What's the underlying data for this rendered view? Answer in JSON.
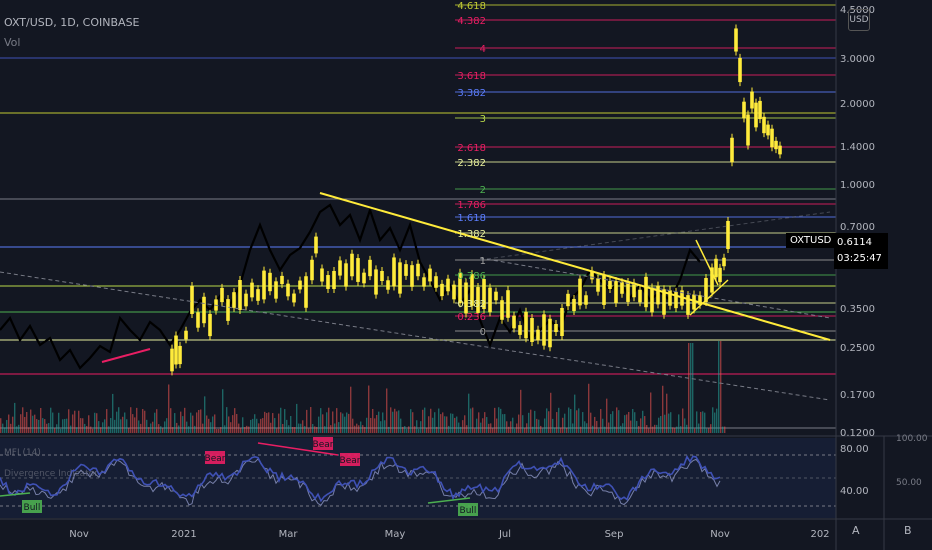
{
  "header": {
    "symbol_line": "OXT/USD, 1D, COINBASE",
    "volume_label": "Vol",
    "currency_button": "USD"
  },
  "price_axis": {
    "ticks": [
      "4.5000",
      "3.0000",
      "2.0000",
      "1.4000",
      "1.0000",
      "0.7000",
      "0.3500",
      "0.2500",
      "0.1700",
      "0.1200"
    ]
  },
  "last_price": {
    "ticker": "OXTUSD",
    "price": "0.6114",
    "countdown": "03:25:47"
  },
  "fib_levels": [
    {
      "label": "4.618",
      "color": "#c0ca33"
    },
    {
      "label": "4.382",
      "color": "#e91e63"
    },
    {
      "label": "4",
      "color": "#e91e63"
    },
    {
      "label": "3.618",
      "color": "#e91e63"
    },
    {
      "label": "3.382",
      "color": "#5b7cfa"
    },
    {
      "label": "3",
      "color": "#b8d94a"
    },
    {
      "label": "2.618",
      "color": "#e91e63"
    },
    {
      "label": "2.382",
      "color": "#e6ee9c"
    },
    {
      "label": "2",
      "color": "#4caf50"
    },
    {
      "label": "1.786",
      "color": "#e91e63"
    },
    {
      "label": "1.618",
      "color": "#5b7cfa"
    },
    {
      "label": "1.382",
      "color": "#e6ee9c"
    },
    {
      "label": "1",
      "color": "#9e9e9e"
    },
    {
      "label": "0.786",
      "color": "#4caf50"
    },
    {
      "label": "0.382",
      "color": "#e6ee9c"
    },
    {
      "label": "0.236",
      "color": "#e91e63"
    },
    {
      "label": "0",
      "color": "#9e9e9e"
    }
  ],
  "indicator": {
    "title": "MFI (14)",
    "subtitle": "Divergence Indicator",
    "axis_ticks": [
      "80.00",
      "40.00"
    ],
    "right_ticks": [
      "100.00",
      "50.00"
    ],
    "labels": [
      "Bull",
      "Bear",
      "Bear",
      "Bear",
      "Bull"
    ]
  },
  "time_axis": {
    "ticks": [
      "Nov",
      "2021",
      "Mar",
      "May",
      "Jul",
      "Sep",
      "Nov",
      "202"
    ]
  },
  "scale_buttons": [
    "A",
    "B"
  ],
  "chart_data": {
    "type": "line",
    "title": "",
    "xlabel": "",
    "ylabel": "",
    "x": [
      "Nov",
      "Jan",
      "Mar",
      "May",
      "Jul",
      "Sep",
      "Nov"
    ],
    "series": [
      {
        "name": "",
        "values": [
          0.32,
          0.22,
          0.55,
          0.8,
          0.3,
          0.5,
          4.2
        ]
      }
    ],
    "ylim": [
      0.12,
      4.618
    ],
    "log_scale": true,
    "grid": false,
    "colors": {
      "price": "#ffeb3b",
      "history": "#000000",
      "mfi": "#3f51b5",
      "background": "#131722"
    }
  }
}
